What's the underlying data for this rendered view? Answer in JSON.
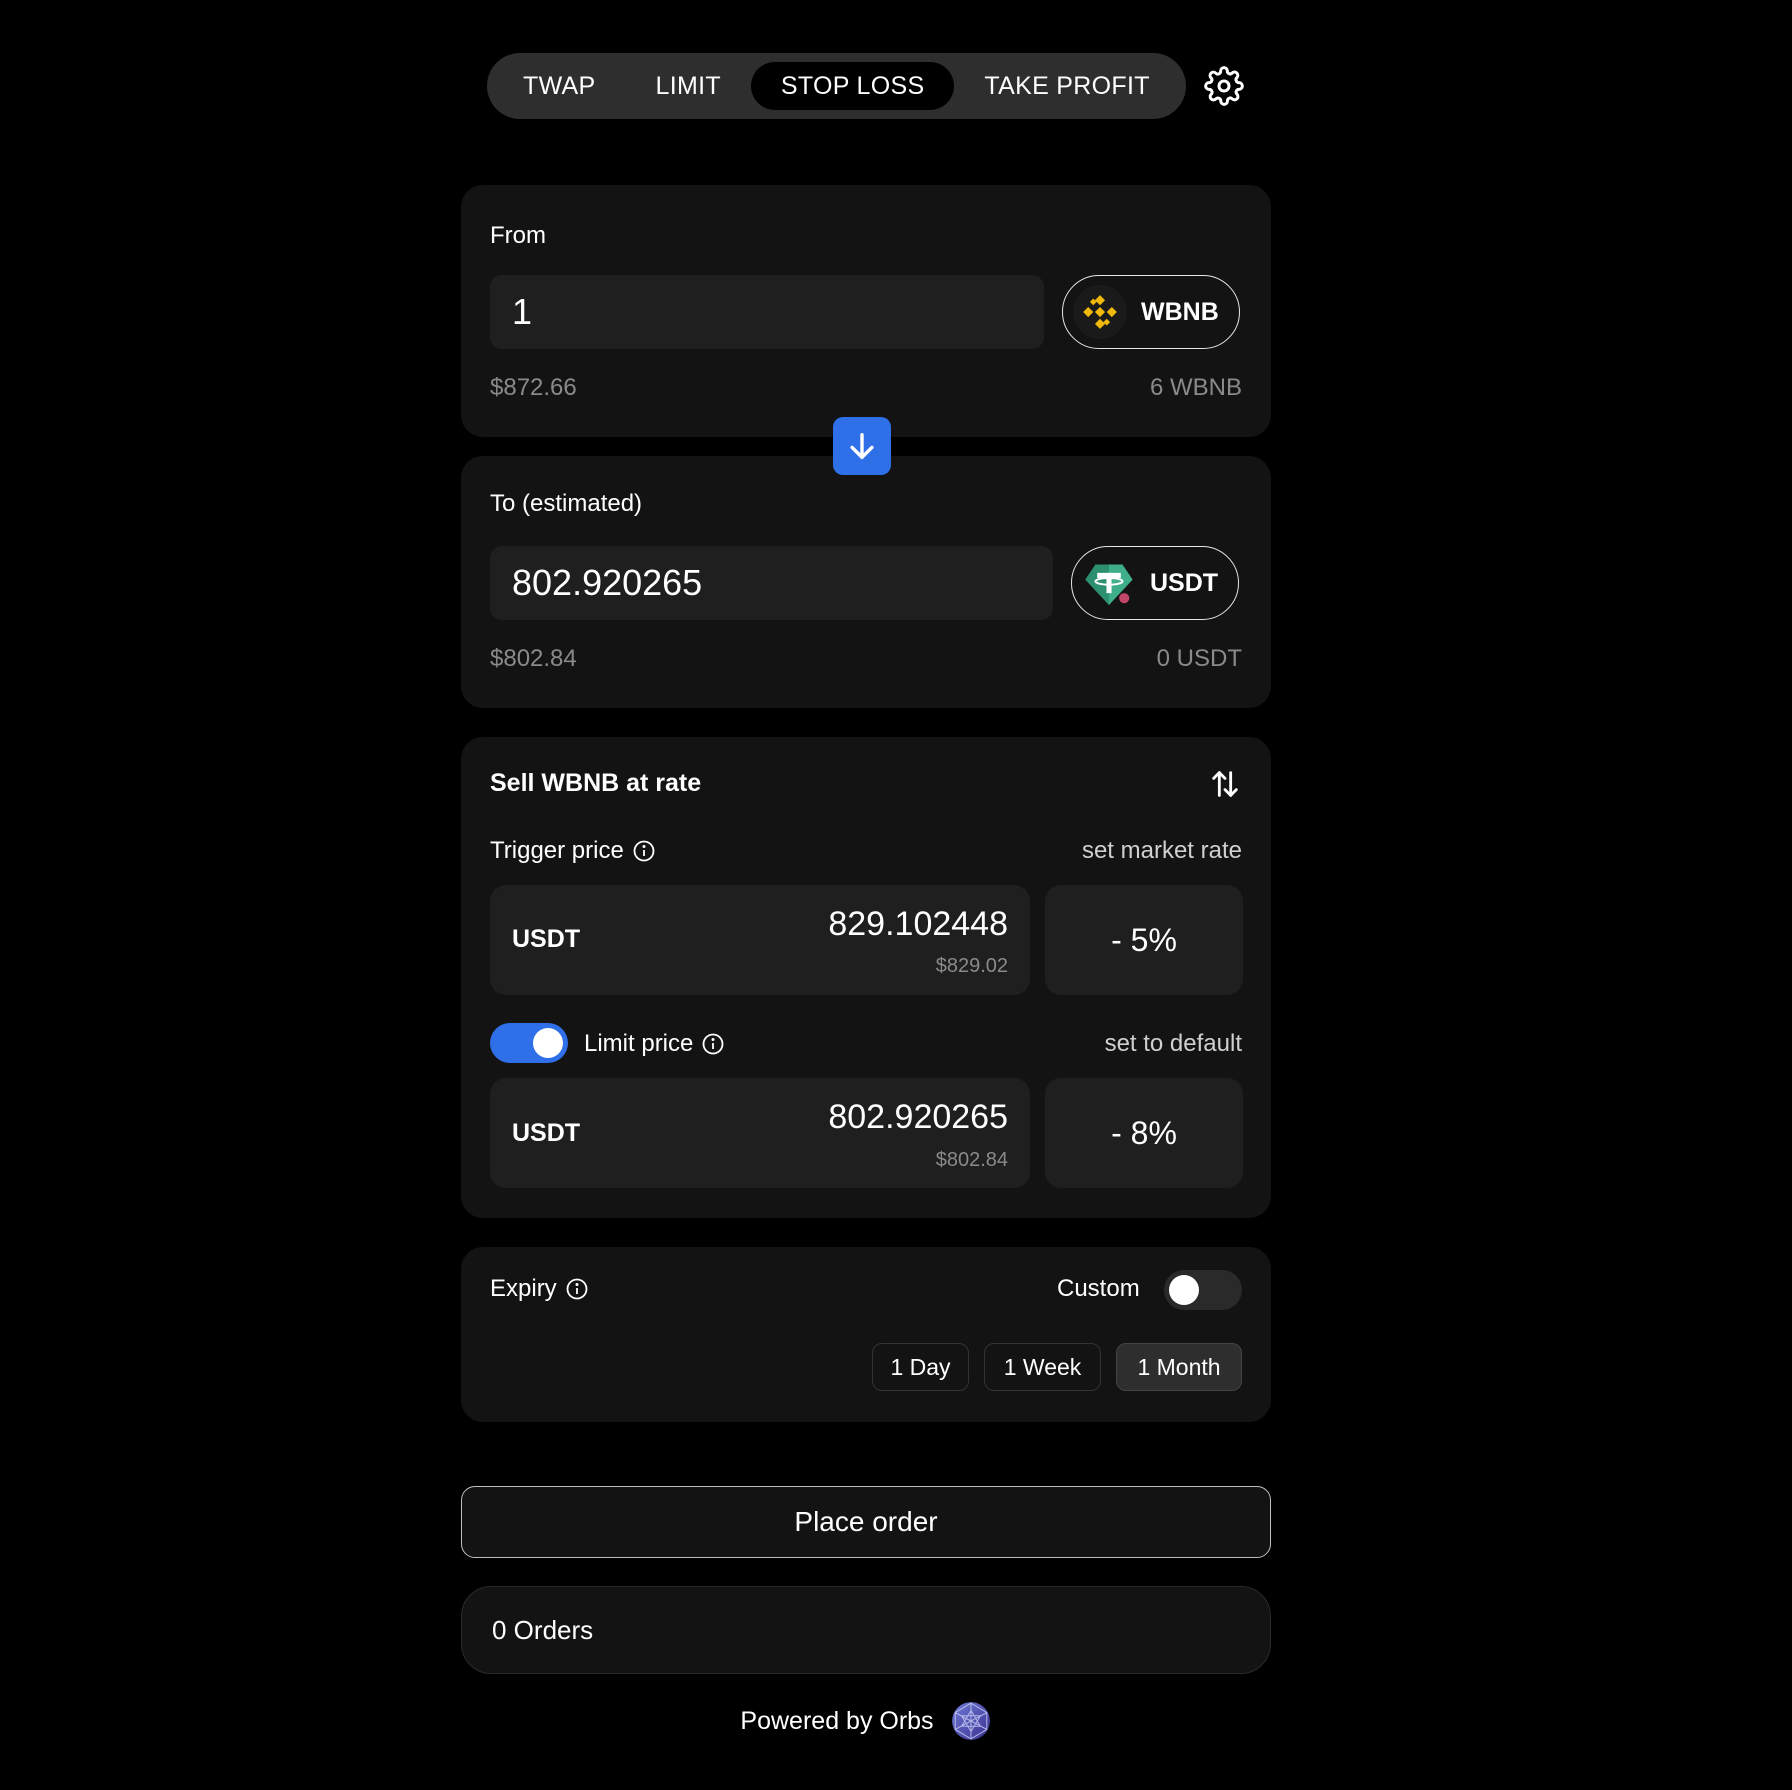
{
  "tabs": [
    {
      "label": "TWAP",
      "active": false
    },
    {
      "label": "LIMIT",
      "active": false
    },
    {
      "label": "STOP LOSS",
      "active": true
    },
    {
      "label": "TAKE PROFIT",
      "active": false
    }
  ],
  "icons": {
    "settings": "gear-icon",
    "swap_direction": "arrow-down-icon",
    "invert_rate": "swap-vertical-icon",
    "info": "info-icon",
    "from_token": "wbnb-token-icon",
    "to_token": "usdt-token-icon",
    "orbs_logo": "orbs-logo-icon"
  },
  "colors": {
    "accent": "#2f6fe8",
    "background": "#000000",
    "card": "#131313",
    "wbnb": "#f0b90b",
    "usdt": "#26a17b"
  },
  "from": {
    "label": "From",
    "amount": "1",
    "token": "WBNB",
    "usd": "$872.66",
    "balance": "6 WBNB"
  },
  "to": {
    "label": "To (estimated)",
    "amount": "802.920265",
    "token": "USDT",
    "usd": "$802.84",
    "balance": "0 USDT"
  },
  "rate": {
    "title": "Sell WBNB at rate",
    "trigger": {
      "label": "Trigger price",
      "action": "set market rate",
      "token": "USDT",
      "value": "829.102448",
      "usd": "$829.02",
      "percent": "- 5%"
    },
    "limit": {
      "label": "Limit price",
      "enabled": true,
      "action": "set to default",
      "token": "USDT",
      "value": "802.920265",
      "usd": "$802.84",
      "percent": "- 8%"
    }
  },
  "expiry": {
    "label": "Expiry",
    "custom_label": "Custom",
    "custom_enabled": false,
    "options": [
      {
        "label": "1 Day",
        "selected": false
      },
      {
        "label": "1 Week",
        "selected": false
      },
      {
        "label": "1 Month",
        "selected": true
      }
    ]
  },
  "place_order_label": "Place order",
  "orders_label": "0 Orders",
  "powered_by": "Powered by Orbs"
}
